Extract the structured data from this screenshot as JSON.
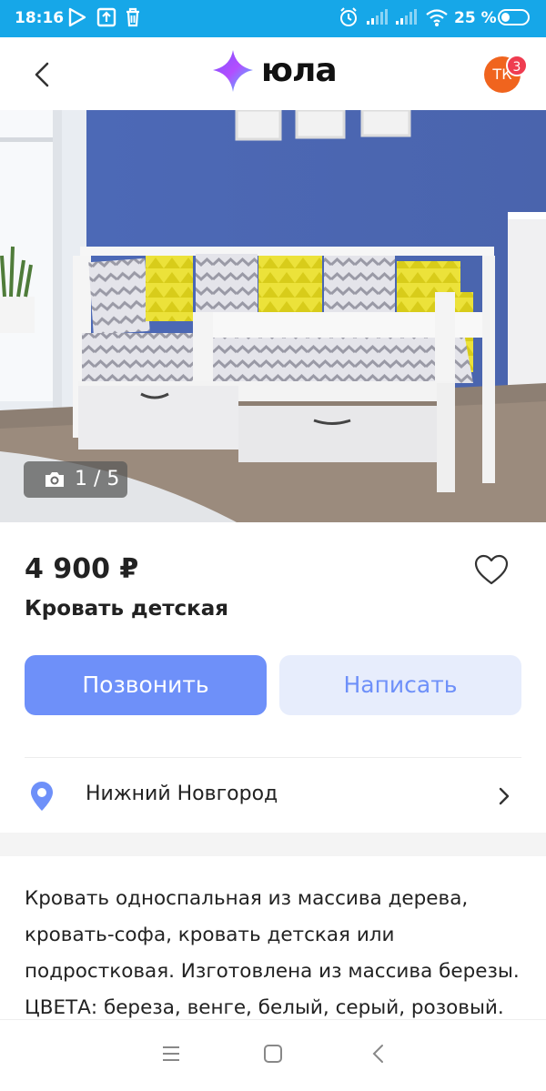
{
  "status_bar": {
    "time": "18:16",
    "battery": "25 %",
    "icons": [
      "play-store-icon",
      "upload-icon",
      "trash-icon",
      "alarm-icon",
      "signal-icon",
      "signal-icon-2",
      "wifi-icon",
      "battery-icon"
    ]
  },
  "header": {
    "logo_text": "юла",
    "avatar_initials": "ТК",
    "notifications_count": "3",
    "back_icon": "back-arrow-icon"
  },
  "photo": {
    "counter": "1 / 5",
    "icon": "camera-icon"
  },
  "listing": {
    "price": "4 900 ₽",
    "title": "Кровать детская"
  },
  "actions": {
    "call_label": "Позвонить",
    "write_label": "Написать"
  },
  "location": {
    "city": "Нижний Новгород",
    "icon": "location-pin-icon"
  },
  "description": "Кровать односпальная из массива дерева,\nкровать-софа, кровать детская или\nподростковая. Изготовлена из массива березы.\nЦВЕТА: береза, венге, белый, серый, розовый.",
  "colors": {
    "status_bar": "#16a7e8",
    "primary": "#6e90f9",
    "secondary_bg": "#e7edfc",
    "avatar": "#f0641e",
    "badge": "#ef3c50"
  }
}
